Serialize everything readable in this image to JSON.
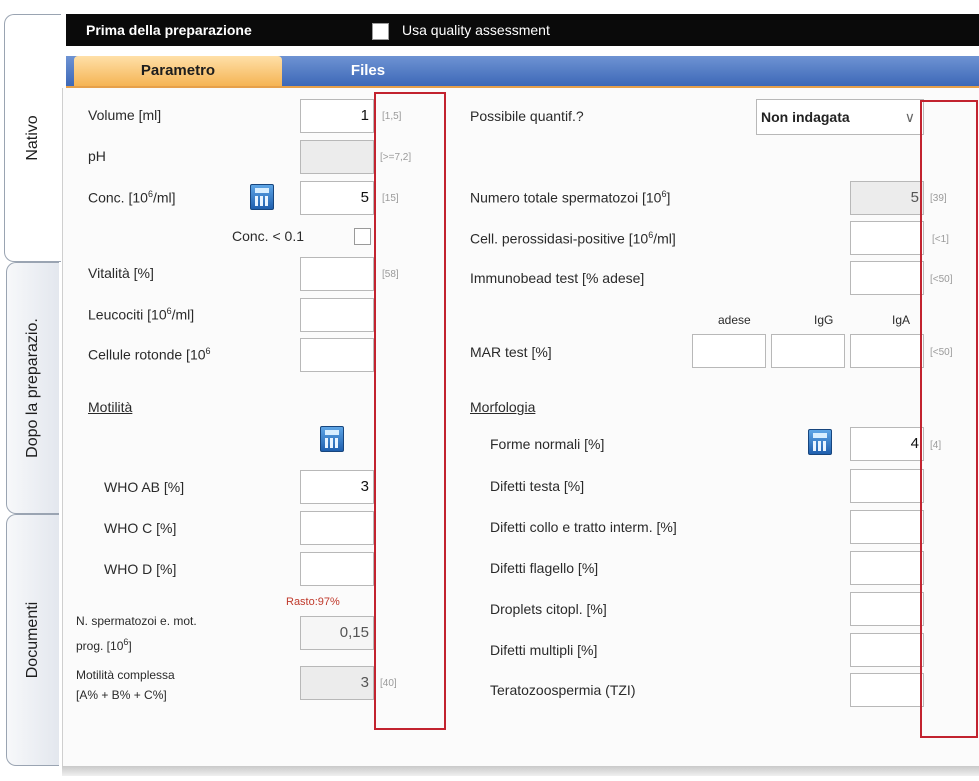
{
  "left_tabs": [
    {
      "label": "Nativo"
    },
    {
      "label": "Dopo la preparazio."
    },
    {
      "label": "Documenti"
    }
  ],
  "header": {
    "title": "Prima della preparazione",
    "qa_label": "Usa quality assessment"
  },
  "subtabs": [
    {
      "label": "Parametro"
    },
    {
      "label": "Files"
    }
  ],
  "left": {
    "volume": {
      "label": "Volume [ml]",
      "value": "1",
      "range": "[1,5]"
    },
    "ph": {
      "label": "pH",
      "value": "",
      "range": "[>=7,2]"
    },
    "conc": {
      "label_pre": "Conc. [10",
      "label_sup": "6",
      "label_post": "/ml]",
      "value": "5",
      "range": "[15]"
    },
    "conc_lt": {
      "label": "Conc. < 0.1"
    },
    "vitalita": {
      "label": "Vitalità [%]",
      "value": "",
      "range": "[58]"
    },
    "leucociti": {
      "label_pre": "Leucociti [10",
      "label_sup": "6",
      "label_post": "/ml]",
      "value": ""
    },
    "cellule": {
      "label_pre": "Cellule rotonde [10",
      "label_sup": "6",
      "value": ""
    },
    "motilita_heading": "Motilità",
    "who_ab": {
      "label": "WHO AB [%]",
      "value": "3"
    },
    "who_c": {
      "label": "WHO C [%]",
      "value": ""
    },
    "who_d": {
      "label": "WHO D [%]",
      "value": ""
    },
    "ratio": "Rasto:97%",
    "n_sperm": {
      "label_l1": "N. spermatozoi e. mot.",
      "label_l2_pre": "prog. [10",
      "label_l2_sup": "6",
      "label_l2_post": "]",
      "value": "0,15"
    },
    "mot_complessa": {
      "label_l1": "Motilità complessa",
      "label_l2": "[A% + B% + C%]",
      "value": "3",
      "range": "[40]"
    }
  },
  "right": {
    "quant": {
      "label": "Possibile quantif.?",
      "value": "Non indagata"
    },
    "tot_sperm": {
      "label_pre": "Numero totale spermatozoi [10",
      "label_sup": "6",
      "label_post": "]",
      "value": "5",
      "range": "[39]"
    },
    "perox": {
      "label_pre": "Cell. perossidasi-positive [10",
      "label_sup": "6",
      "label_post": "/ml]",
      "value": "",
      "range": "[<1]"
    },
    "immuno": {
      "label": "Immunobead test [% adese]",
      "value": "",
      "range": "[<50]"
    },
    "mar": {
      "label": "MAR test [%]",
      "col_adese": "adese",
      "col_igg": "IgG",
      "col_iga": "IgA",
      "range": "[<50]"
    },
    "morfologia_heading": "Morfologia",
    "forme": {
      "label": "Forme normali [%]",
      "value": "4",
      "range": "[4]"
    },
    "testa": {
      "label": "Difetti testa [%]",
      "value": ""
    },
    "collo": {
      "label": "Difetti collo e tratto interm. [%]",
      "value": ""
    },
    "flagello": {
      "label": "Difetti flagello [%]",
      "value": ""
    },
    "droplets": {
      "label": "Droplets citopl. [%]",
      "value": ""
    },
    "multipli": {
      "label": "Difetti multipli [%]",
      "value": ""
    },
    "tzi": {
      "label": "Teratozoospermia (TZI)",
      "value": ""
    }
  },
  "colors": {
    "accent_red": "#c2232f",
    "tab_active": "#f5b454",
    "tab_bar": "#3d68b7"
  }
}
